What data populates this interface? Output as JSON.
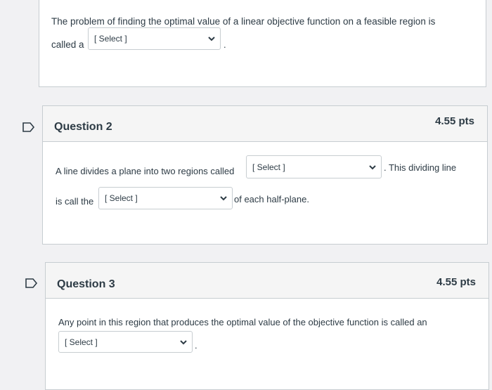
{
  "question1": {
    "text_line1": "The problem of finding the optimal value of a linear objective function on a feasible region is",
    "text_prefix": "called a",
    "select_value": "[ Select ]",
    "text_suffix": "."
  },
  "question2": {
    "title": "Question 2",
    "points": "4.55 pts",
    "text_part1": "A line divides a plane into two regions called",
    "select1_value": "[ Select ]",
    "text_part2": ". This dividing line",
    "text_part3": "is call the",
    "select2_value": "[ Select ]",
    "text_part4": "of each half-plane."
  },
  "question3": {
    "title": "Question 3",
    "points": "4.55 pts",
    "text_line1": "Any point in this region that produces the optimal value of the objective function is called an",
    "select_value": "[ Select ]",
    "text_suffix": "."
  },
  "colors": {
    "page_background": "#f1f1f3",
    "card_border": "#c7cdd1",
    "header_background": "#f5f5f5",
    "text": "#2d3b45"
  },
  "icons": {
    "flag": "flag-icon",
    "dropdown": "chevron-down-icon"
  }
}
